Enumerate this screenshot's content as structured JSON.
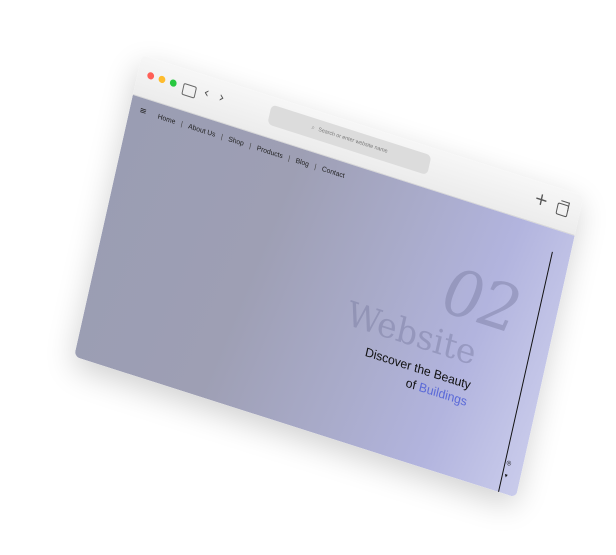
{
  "window": {
    "traffic_lights": [
      "#ff5f57",
      "#febc2e",
      "#28c840"
    ],
    "address_placeholder": "Search or enter website name"
  },
  "nav": {
    "items": [
      "Home",
      "About Us",
      "Shop",
      "Products",
      "Blog",
      "Contact"
    ],
    "separator": "|"
  },
  "hero": {
    "number": "02",
    "word": "Website",
    "line1": "Discover the Beauty",
    "line2_prefix": "of ",
    "line2_accent": "Buildings",
    "accent_color": "#5a69d8"
  },
  "icons": {
    "menu": "hamburger-icon",
    "sidebar": "sidebar-toggle-icon",
    "back": "chevron-left-icon",
    "forward": "chevron-right-icon",
    "search": "search-icon",
    "new_tab": "plus-icon",
    "tabs": "tabs-overview-icon",
    "social": [
      "instagram-icon",
      "twitter-icon"
    ]
  }
}
